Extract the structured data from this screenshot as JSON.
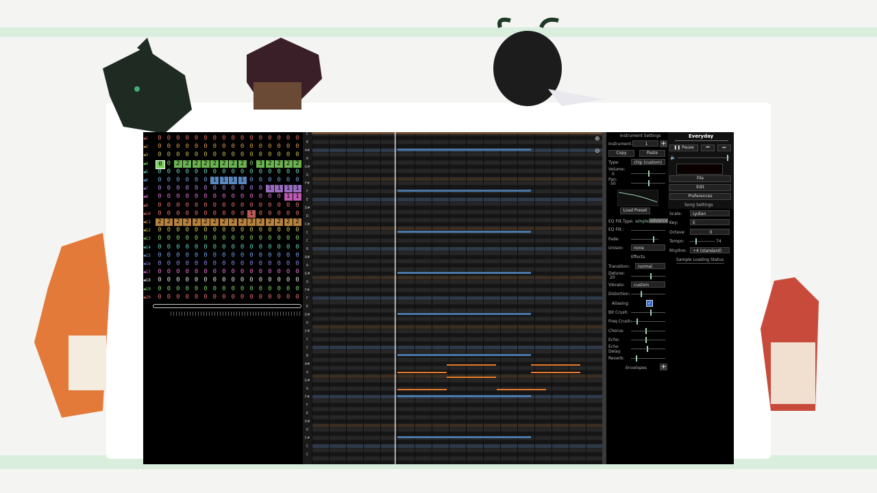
{
  "song": {
    "title": "Everyday",
    "pause_label": "Pause"
  },
  "instrument_settings": {
    "header": "Instrument Settings",
    "instrument_label": "Instrument:",
    "instrument_value": "1",
    "copy_label": "Copy",
    "paste_label": "Paste",
    "type_label": "Type:",
    "type_value": "chip (custom)",
    "volume_label": "Volume:",
    "volume_value": "0",
    "pan_label": "Pan:",
    "pan_value": "50",
    "load_preset_label": "Load Preset",
    "eq_filt_type_label": "EQ Filt.Type:",
    "eq_simple": "simple",
    "eq_advanced": "advanced",
    "eq_filt_label": "EQ Filt.:",
    "fade_label": "Fade:",
    "unison_label": "Unison:",
    "unison_value": "none",
    "effects_label": "Effects",
    "transition_label": "Transition:",
    "transition_value": "normal",
    "detune_label": "Detune:",
    "detune_value": "20",
    "vibrato_label": "Vibrato:",
    "vibrato_value": "custom",
    "distortion_label": "Distortion:",
    "aliasing_label": "Aliasing:",
    "bitcrush_label": "Bit Crush:",
    "freqcrush_label": "Freq Crush:",
    "chorus_label": "Chorus:",
    "echo_label": "Echo:",
    "echo_delay_label": "Echo Delay:",
    "reverb_label": "Reverb:",
    "envelopes_label": "Envelopes"
  },
  "song_settings": {
    "file_label": "File",
    "edit_label": "Edit",
    "preferences_label": "Preferences",
    "header": "Song Settings",
    "scale_label": "Scale:",
    "scale_value": "Lydian",
    "key_label": "Key:",
    "key_value": "E",
    "octave_label": "Octave:",
    "octave_value": "0",
    "tempo_label": "Tempo:",
    "tempo_value": "74",
    "rhythm_label": "Rhythm:",
    "rhythm_value": "÷4 (standard)",
    "sample_status": "Sample Loading Status"
  },
  "pattern_rows": [
    {
      "label": "1",
      "color": "#e06a5a",
      "cells": [
        "0",
        "0",
        "0",
        "0",
        "0",
        "0",
        "0",
        "0",
        "0",
        "0",
        "0",
        "0",
        "0",
        "0",
        "0",
        "0"
      ]
    },
    {
      "label": "2",
      "color": "#d79a4a",
      "cells": [
        "0",
        "0",
        "0",
        "0",
        "0",
        "0",
        "0",
        "0",
        "0",
        "0",
        "0",
        "0",
        "0",
        "0",
        "0",
        "0"
      ]
    },
    {
      "label": "3",
      "color": "#c6b64a",
      "cells": [
        "0",
        "0",
        "0",
        "0",
        "0",
        "0",
        "0",
        "0",
        "0",
        "0",
        "0",
        "0",
        "0",
        "0",
        "0",
        "0"
      ]
    },
    {
      "label": "4",
      "color": "#7ed25f",
      "cells": [
        "0",
        "0",
        "2",
        "2",
        "2",
        "2",
        "2",
        "2",
        "2",
        "2",
        "0",
        "3",
        "2",
        "2",
        "2",
        "2"
      ]
    },
    {
      "label": "5",
      "color": "#5fcfb8",
      "cells": [
        "0",
        "0",
        "0",
        "0",
        "0",
        "0",
        "0",
        "0",
        "0",
        "0",
        "0",
        "0",
        "0",
        "0",
        "0",
        "0"
      ]
    },
    {
      "label": "6",
      "color": "#6aa0e0",
      "cells": [
        "0",
        "0",
        "0",
        "0",
        "0",
        "0",
        "1",
        "1",
        "1",
        "1",
        "0",
        "0",
        "0",
        "0",
        "0",
        "0"
      ]
    },
    {
      "label": "7",
      "color": "#b27fe0",
      "cells": [
        "0",
        "0",
        "0",
        "0",
        "0",
        "0",
        "0",
        "0",
        "0",
        "0",
        "0",
        "0",
        "1",
        "1",
        "1",
        "1"
      ]
    },
    {
      "label": "8",
      "color": "#e06ad0",
      "cells": [
        "0",
        "0",
        "0",
        "0",
        "0",
        "0",
        "0",
        "0",
        "0",
        "0",
        "0",
        "0",
        "0",
        "0",
        "1",
        "1"
      ]
    },
    {
      "label": "9",
      "color": "#e06a6a",
      "cells": [
        "0",
        "0",
        "0",
        "0",
        "0",
        "0",
        "0",
        "0",
        "0",
        "0",
        "0",
        "0",
        "0",
        "0",
        "0",
        "0"
      ]
    },
    {
      "label": "10",
      "color": "#e06a6a",
      "cells": [
        "0",
        "0",
        "0",
        "0",
        "0",
        "0",
        "0",
        "0",
        "0",
        "0",
        "1",
        "0",
        "0",
        "0",
        "0",
        "0"
      ]
    },
    {
      "label": "11",
      "color": "#d7984a",
      "cells": [
        "2",
        "2",
        "2",
        "2",
        "2",
        "2",
        "2",
        "2",
        "2",
        "2",
        "3",
        "2",
        "2",
        "2",
        "2",
        "2"
      ]
    },
    {
      "label": "12",
      "color": "#c6c04a",
      "cells": [
        "0",
        "0",
        "0",
        "0",
        "0",
        "0",
        "0",
        "0",
        "0",
        "0",
        "0",
        "0",
        "0",
        "0",
        "0",
        "0"
      ]
    },
    {
      "label": "13",
      "color": "#7ed25f",
      "cells": [
        "0",
        "0",
        "0",
        "0",
        "0",
        "0",
        "0",
        "0",
        "0",
        "0",
        "0",
        "0",
        "0",
        "0",
        "0",
        "0"
      ]
    },
    {
      "label": "14",
      "color": "#5fcfb8",
      "cells": [
        "0",
        "0",
        "0",
        "0",
        "0",
        "0",
        "0",
        "0",
        "0",
        "0",
        "0",
        "0",
        "0",
        "0",
        "0",
        "0"
      ]
    },
    {
      "label": "15",
      "color": "#6aa0e0",
      "cells": [
        "0",
        "0",
        "0",
        "0",
        "0",
        "0",
        "0",
        "0",
        "0",
        "0",
        "0",
        "0",
        "0",
        "0",
        "0",
        "0"
      ]
    },
    {
      "label": "16",
      "color": "#8a7fe0",
      "cells": [
        "0",
        "0",
        "0",
        "0",
        "0",
        "0",
        "0",
        "0",
        "0",
        "0",
        "0",
        "0",
        "0",
        "0",
        "0",
        "0"
      ]
    },
    {
      "label": "17",
      "color": "#e06ad0",
      "cells": [
        "0",
        "0",
        "0",
        "0",
        "0",
        "0",
        "0",
        "0",
        "0",
        "0",
        "0",
        "0",
        "0",
        "0",
        "0",
        "0"
      ]
    },
    {
      "label": "18",
      "color": "#e0e0e0",
      "cells": [
        "0",
        "0",
        "0",
        "0",
        "0",
        "0",
        "0",
        "0",
        "0",
        "0",
        "0",
        "0",
        "0",
        "0",
        "0",
        "0"
      ]
    },
    {
      "label": "19",
      "color": "#7ed25f",
      "cells": [
        "0",
        "0",
        "0",
        "0",
        "0",
        "0",
        "0",
        "0",
        "0",
        "0",
        "0",
        "0",
        "0",
        "0",
        "0",
        "0"
      ]
    },
    {
      "label": "20",
      "color": "#e06a6a",
      "cells": [
        "0",
        "0",
        "0",
        "0",
        "0",
        "0",
        "0",
        "0",
        "0",
        "0",
        "0",
        "0",
        "0",
        "0",
        "0",
        "0"
      ]
    }
  ],
  "piano_keys": [
    "C",
    "B",
    "A#",
    "A",
    "G#",
    "G",
    "F#",
    "F",
    "E",
    "D#",
    "D",
    "C#",
    "C"
  ],
  "colors": {
    "roll_orange": "#e87a2a",
    "roll_blue": "#4a78a8",
    "roll_brown": "#6a4a30",
    "slider_knob": "#9fd3b0"
  }
}
